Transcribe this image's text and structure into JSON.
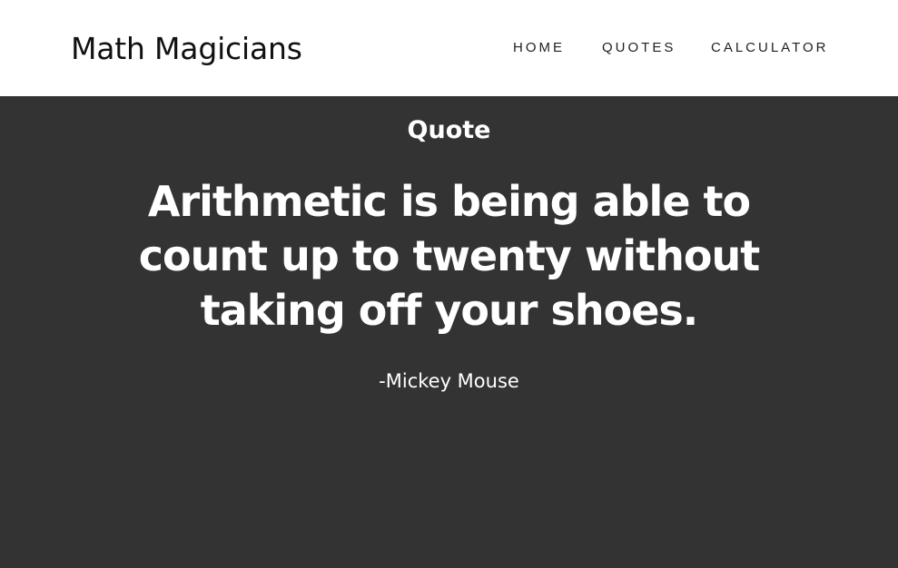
{
  "header": {
    "brand": "Math Magicians",
    "nav": [
      {
        "label": "HOME"
      },
      {
        "label": "QUOTES"
      },
      {
        "label": "CALCULATOR"
      }
    ]
  },
  "main": {
    "title": "Quote",
    "quote": "Arithmetic is being able to count up to twenty without taking off your shoes.",
    "author": "-Mickey Mouse"
  },
  "colors": {
    "header_bg": "#ffffff",
    "main_bg": "#333333",
    "text_light": "#ffffff",
    "text_dark": "#111111"
  }
}
